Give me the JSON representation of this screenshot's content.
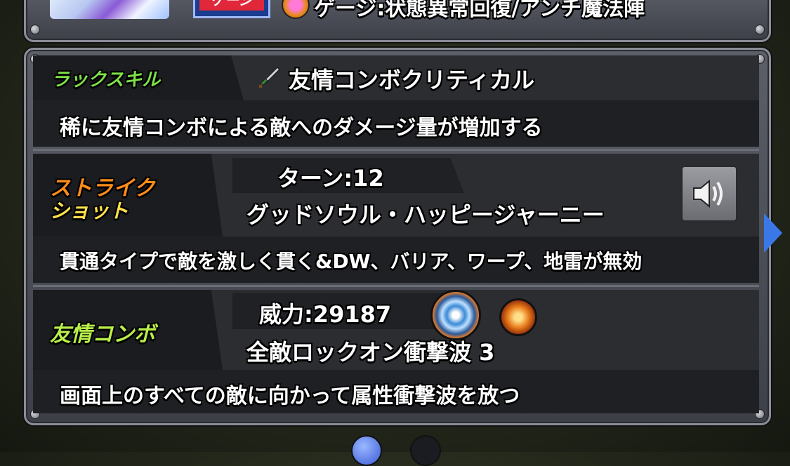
{
  "header": {
    "badge_text": "ゲージ",
    "ability_text": "ゲージ:状態異常回復/アンチ魔法陣"
  },
  "luck_skill": {
    "label": "ラックスキル",
    "name": "友情コンボクリティカル",
    "description": "稀に友情コンボによる敵へのダメージ量が増加する"
  },
  "strike_shot": {
    "label_line1": "ストライク",
    "label_line2": "ショット",
    "turn": "ターン:12",
    "name": "グッドソウル・ハッピージャーニー",
    "description": "貫通タイプで敵を激しく貫く&DW、バリア、ワープ、地雷が無効"
  },
  "friend_combo": {
    "label": "友情コンボ",
    "power": "威力:29187",
    "name": "全敵ロックオン衝撃波 3",
    "description": "画面上のすべての敵に向かって属性衝撃波を放つ"
  },
  "pager": {
    "page_count": 2,
    "active_index": 0
  },
  "colors": {
    "luck_label": "#7ee04a",
    "strike_label_top": "#ff8c1a",
    "strike_label_bottom": "#ffe24a",
    "friend_label": "#b8f04a"
  }
}
